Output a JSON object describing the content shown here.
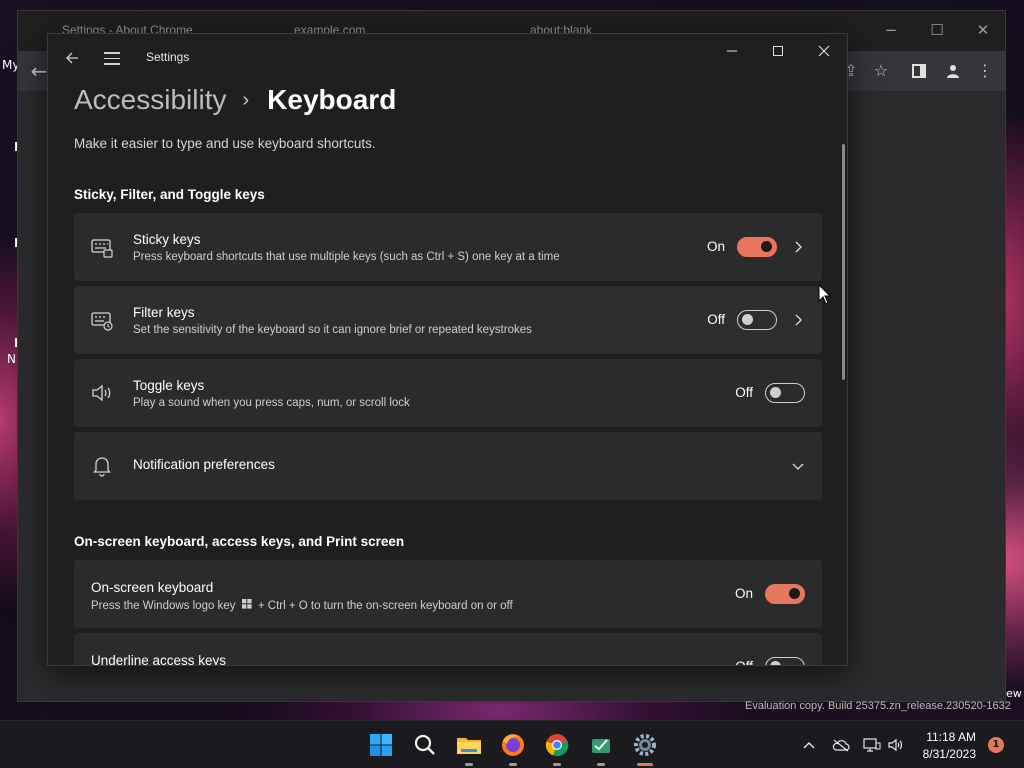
{
  "desktop": {
    "left_labels": [
      "My",
      "N",
      "I"
    ],
    "bottom_right_label": "ew",
    "watermark": "Evaluation copy. Build 25375.zn_release.230520-1632"
  },
  "browser": {
    "tabs": [
      "Settings - About Chrome",
      "example.com",
      "about:blank"
    ],
    "window_controls": [
      "−",
      "☐",
      "✕"
    ]
  },
  "settings_window": {
    "title": "Settings",
    "breadcrumb": {
      "parent": "Accessibility",
      "separator": "›",
      "current": "Keyboard"
    },
    "description": "Make it easier to type and use keyboard shortcuts.",
    "section1_title": "Sticky, Filter, and Toggle keys",
    "section2_title": "On-screen keyboard, access keys, and Print screen",
    "items": [
      {
        "icon": "sticky-keys-icon",
        "title": "Sticky keys",
        "subtitle": "Press keyboard shortcuts that use multiple keys (such as Ctrl + S) one key at a time",
        "state": "On",
        "toggle_on": true,
        "has_chevron": true
      },
      {
        "icon": "filter-keys-icon",
        "title": "Filter keys",
        "subtitle": "Set the sensitivity of the keyboard so it can ignore brief or repeated keystrokes",
        "state": "Off",
        "toggle_on": false,
        "has_chevron": true
      },
      {
        "icon": "speaker-icon",
        "title": "Toggle keys",
        "subtitle": "Play a sound when you press caps, num, or scroll lock",
        "state": "Off",
        "toggle_on": false,
        "has_chevron": false
      },
      {
        "icon": "bell-icon",
        "title": "Notification preferences",
        "expandable": true
      },
      {
        "title": "On-screen keyboard",
        "subtitle_before": "Press the Windows logo key",
        "subtitle_after": "+ Ctrl + O to turn the on-screen keyboard on or off",
        "state": "On",
        "toggle_on": true
      },
      {
        "title": "Underline access keys",
        "state": "Off",
        "toggle_on": false
      }
    ]
  },
  "taskbar": {
    "apps": [
      "start-icon",
      "search-icon",
      "file-explorer-icon",
      "firefox-icon",
      "chrome-icon",
      "app-icon",
      "settings-icon"
    ],
    "time": "11:18 AM",
    "date": "8/31/2023",
    "notification_count": "1"
  },
  "colors": {
    "accent": "#e8765e",
    "card_bg": "#2b2b2b",
    "window_bg": "#1f1f1f"
  }
}
